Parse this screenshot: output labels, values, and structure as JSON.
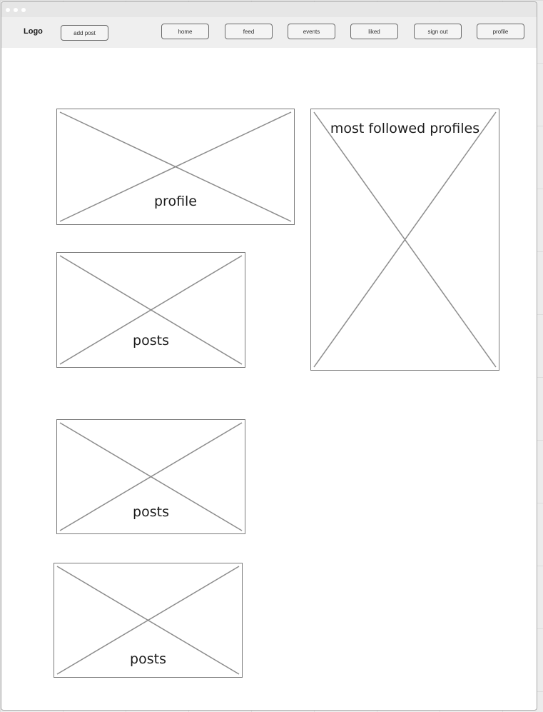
{
  "header": {
    "logo": "Logo",
    "add_post": "add post",
    "nav": {
      "home": "home",
      "feed": "feed",
      "events": "events",
      "liked": "liked",
      "sign_out": "sign out",
      "profile": "profile"
    }
  },
  "main": {
    "profile_label": "profile",
    "most_followed_label": "most followed profiles",
    "posts": [
      {
        "label": "posts"
      },
      {
        "label": "posts"
      },
      {
        "label": "posts"
      }
    ]
  }
}
